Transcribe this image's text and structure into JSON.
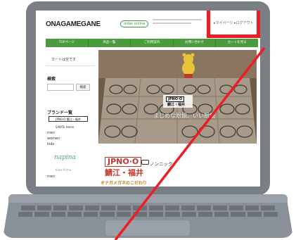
{
  "header": {
    "logo": "ONAGAMEGANE",
    "badge": "order online",
    "mypage": "マイページ",
    "logout": "ログアウト"
  },
  "nav": {
    "items": [
      "TOPページ",
      "商品一覧",
      "ご利用案内",
      "お問い合わせ",
      "カートを見る"
    ]
  },
  "sidebar": {
    "cart_text": "カートは空です",
    "search_heading": "検索",
    "search_button": "検索",
    "brand_heading": "ブランド一覧",
    "brand_jpnoo": "JPNO·O 鯖江・福井",
    "brand_sawatoshome": "SAWTo Home",
    "categories": [
      "men",
      "women",
      "kids"
    ],
    "brand_napina": "napina",
    "brand_prime": "Kiwa Prime",
    "men2": "men"
  },
  "hero": {
    "logo_line1": "JPNO·O",
    "logo_line2": "鯖江・福井",
    "tagline": "まじめな眼鏡、いい眼鏡"
  },
  "content": {
    "jpnoo_line1": "JPNO·O",
    "jpnoo_line2": "鯖江・福井",
    "nonshikku": "ノンニック",
    "kodawari": "オナガメガネのこだわり"
  },
  "colors": {
    "nav_green": "#4a9b3e",
    "callout_red": "#ee1c24",
    "brand_red": "#c0392b"
  }
}
